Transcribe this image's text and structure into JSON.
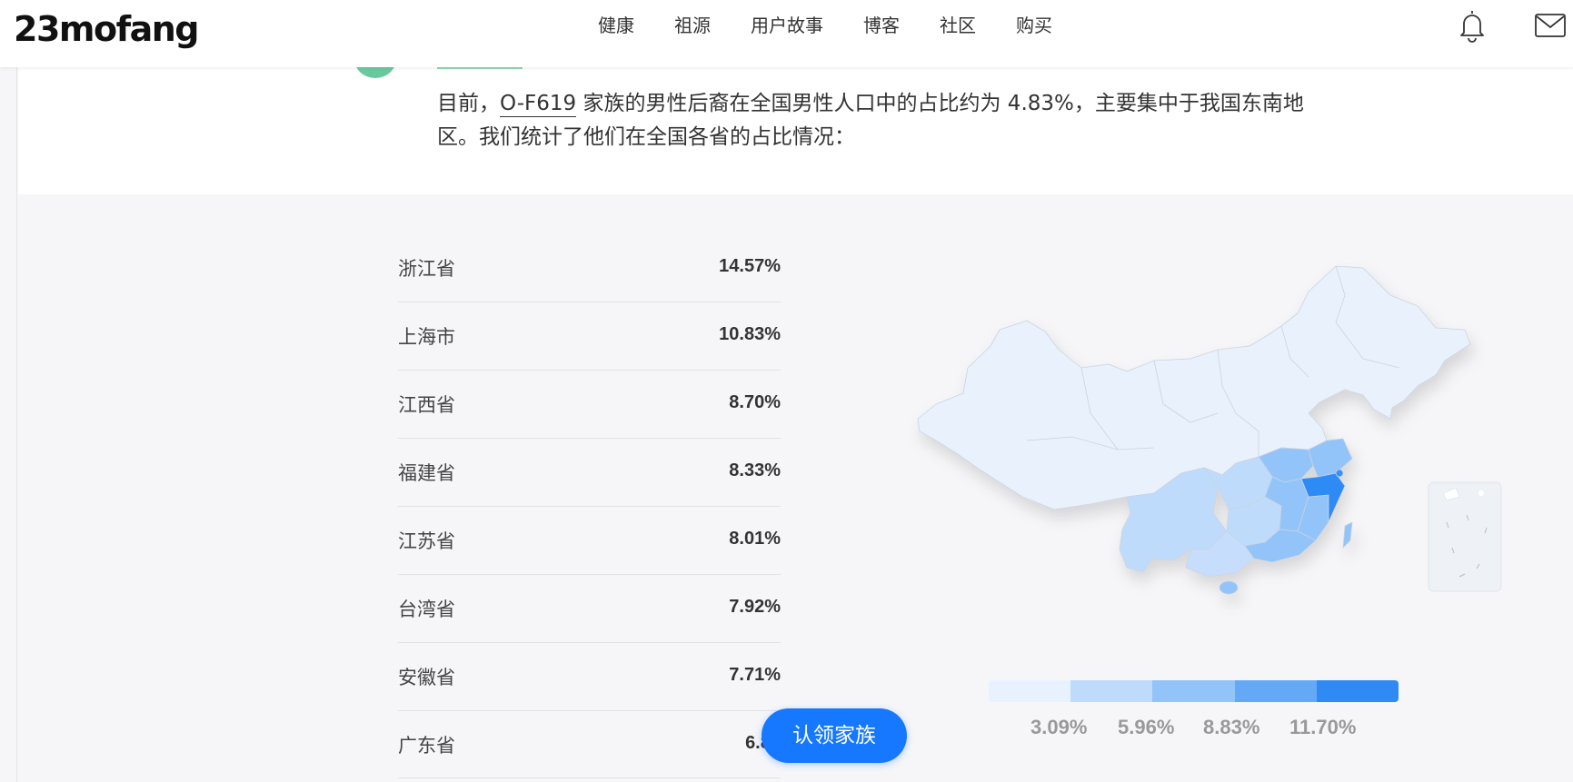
{
  "header": {
    "logo": "23mofang",
    "nav": [
      "健康",
      "祖源",
      "用户故事",
      "博客",
      "社区",
      "购买"
    ]
  },
  "intro": {
    "text_before": "目前，",
    "haplogroup": "O-F619",
    "text_after": " 家族的男性后裔在全国男性人口中的占比约为 4.83%，主要集中于我国东南地区。我们统计了他们在全国各省的占比情况："
  },
  "province_table": [
    {
      "name": "浙江省",
      "percent": "14.57%"
    },
    {
      "name": "上海市",
      "percent": "10.83%"
    },
    {
      "name": "江西省",
      "percent": "8.70%"
    },
    {
      "name": "福建省",
      "percent": "8.33%"
    },
    {
      "name": "江苏省",
      "percent": "8.01%"
    },
    {
      "name": "台湾省",
      "percent": "7.92%"
    },
    {
      "name": "安徽省",
      "percent": "7.71%"
    },
    {
      "name": "广东省",
      "percent": "6.89"
    }
  ],
  "claim_button": "认领家族",
  "legend": {
    "colors": [
      "#e8f2fe",
      "#bfdbfb",
      "#93c4f9",
      "#63a9f6",
      "#2f8af4"
    ],
    "ticks": [
      "3.09%",
      "5.96%",
      "8.83%",
      "11.70%"
    ]
  },
  "icons": {
    "bell": "bell-icon",
    "mail": "mail-icon"
  }
}
